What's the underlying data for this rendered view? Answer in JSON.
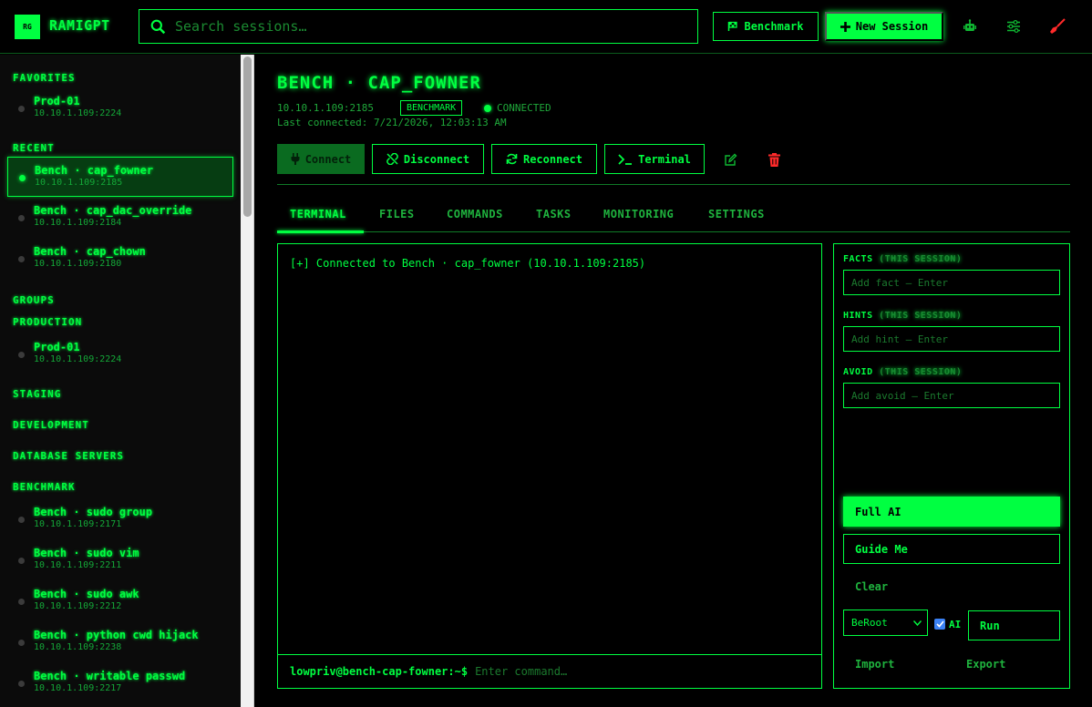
{
  "header": {
    "logo_text": "RG",
    "brand": "RAMIGPT",
    "search_placeholder": "Search sessions…",
    "benchmark_label": "Benchmark",
    "new_session_label": "New Session"
  },
  "sidebar": {
    "favorites_label": "FAVORITES",
    "favorites": [
      {
        "name": "Prod-01",
        "addr": "10.10.1.109:2224"
      }
    ],
    "recent_label": "RECENT",
    "recent": [
      {
        "name": "Bench · cap_fowner",
        "addr": "10.10.1.109:2185"
      },
      {
        "name": "Bench · cap_dac_override",
        "addr": "10.10.1.109:2184"
      },
      {
        "name": "Bench · cap_chown",
        "addr": "10.10.1.109:2180"
      }
    ],
    "groups_label": "GROUPS",
    "production_label": "PRODUCTION",
    "production": [
      {
        "name": "Prod-01",
        "addr": "10.10.1.109:2224"
      }
    ],
    "staging_label": "STAGING",
    "development_label": "DEVELOPMENT",
    "database_label": "DATABASE SERVERS",
    "benchmark_label": "BENCHMARK",
    "benchmark": [
      {
        "name": "Bench · sudo group",
        "addr": "10.10.1.109:2171"
      },
      {
        "name": "Bench · sudo vim",
        "addr": "10.10.1.109:2211"
      },
      {
        "name": "Bench · sudo awk",
        "addr": "10.10.1.109:2212"
      },
      {
        "name": "Bench · python cwd hijack",
        "addr": "10.10.1.109:2238"
      },
      {
        "name": "Bench · writable passwd",
        "addr": "10.10.1.109:2217"
      }
    ]
  },
  "session": {
    "title": "BENCH · CAP_FOWNER",
    "address": "10.10.1.109:2185",
    "badge": "BENCHMARK",
    "status": "CONNECTED",
    "last_connected": "Last connected: 7/21/2026, 12:03:13 AM"
  },
  "actions": {
    "connect": "Connect",
    "disconnect": "Disconnect",
    "reconnect": "Reconnect",
    "terminal": "Terminal"
  },
  "tabs": [
    "TERMINAL",
    "FILES",
    "COMMANDS",
    "TASKS",
    "MONITORING",
    "SETTINGS"
  ],
  "terminal": {
    "output": "[+] Connected to Bench · cap_fowner (10.10.1.109:2185)",
    "prompt": "lowpriv@bench-cap-fowner:~$",
    "input_placeholder": "Enter command…"
  },
  "panel": {
    "facts_label": "FACTS",
    "hints_label": "HINTS",
    "avoid_label": "AVOID",
    "this_session": "(THIS SESSION)",
    "facts_placeholder": "Add fact — Enter",
    "hints_placeholder": "Add hint — Enter",
    "avoid_placeholder": "Add avoid — Enter",
    "full_ai": "Full AI",
    "guide_me": "Guide Me",
    "clear": "Clear",
    "select_value": "BeRoot",
    "ai_label": "AI",
    "ai_checked": true,
    "run": "Run",
    "import": "Import",
    "export": "Export"
  },
  "colors": {
    "accent": "#00ff41",
    "background": "#000000",
    "danger": "#ff2a2a"
  }
}
